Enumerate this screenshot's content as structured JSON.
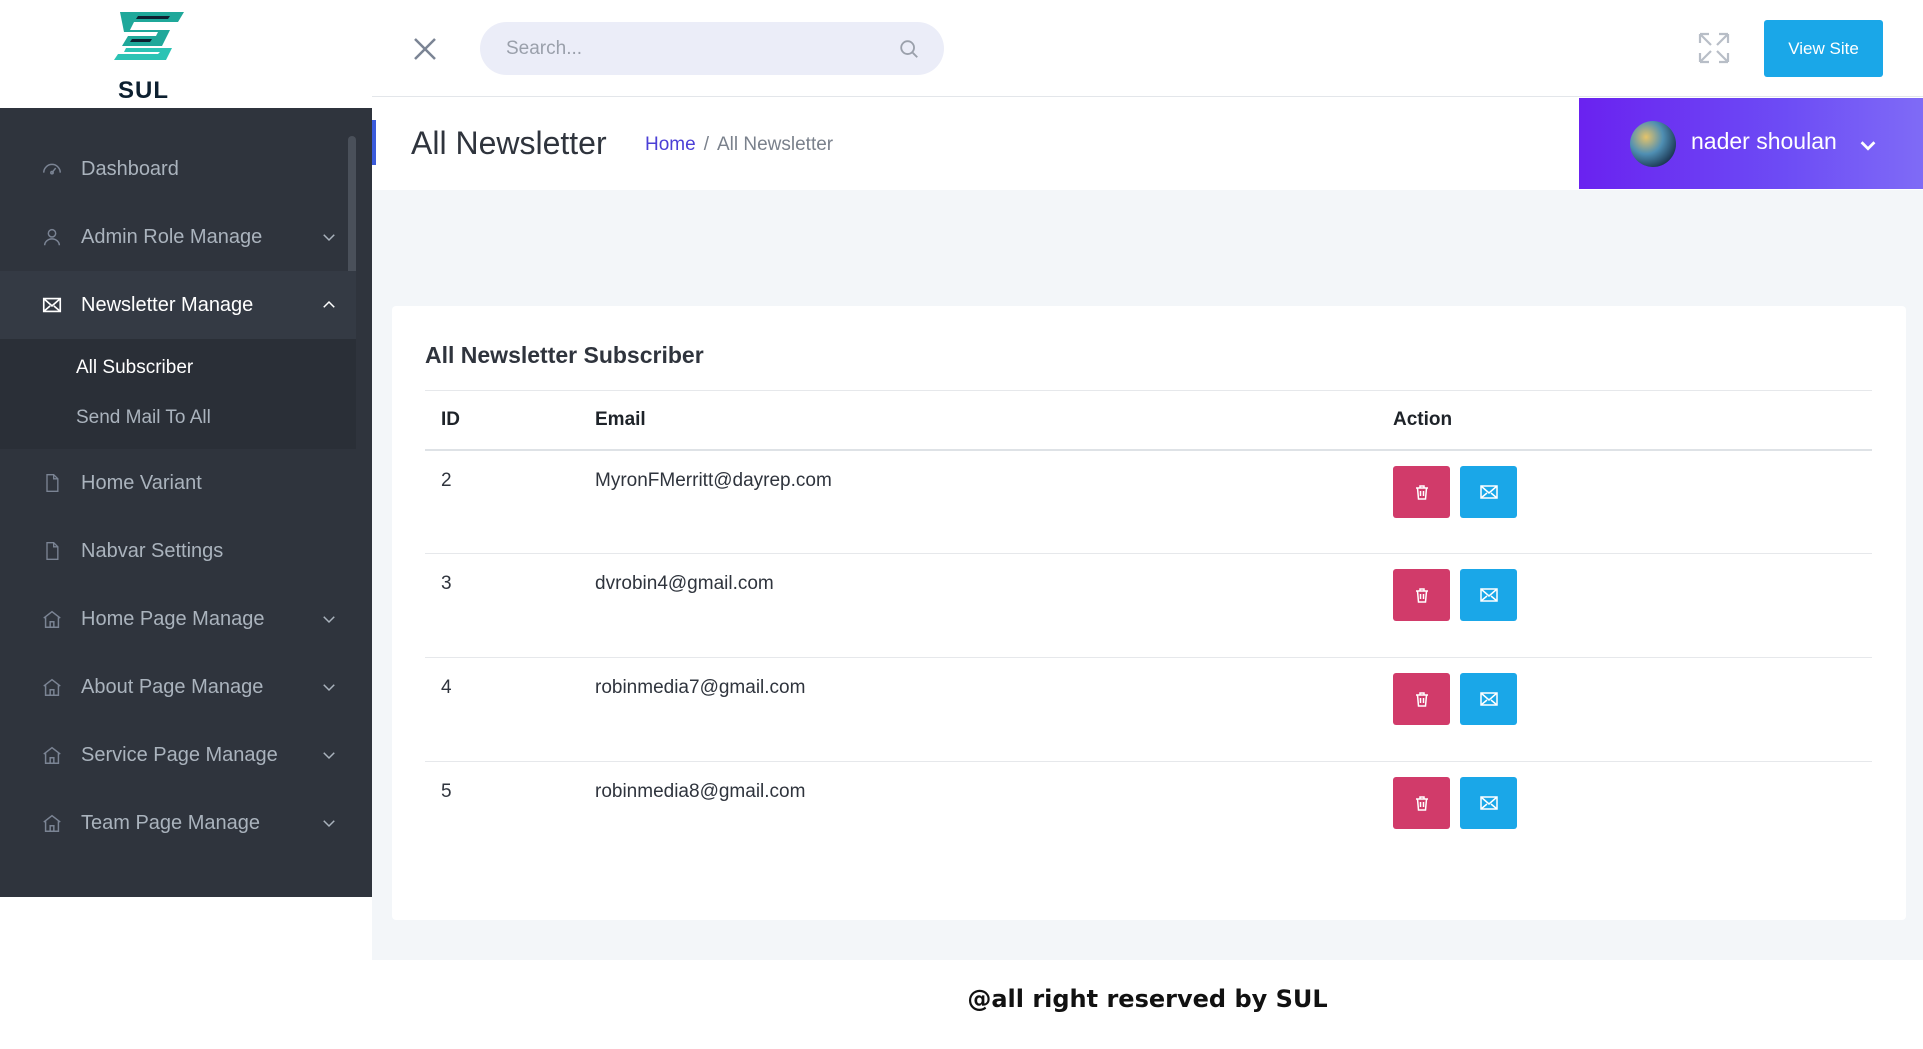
{
  "brand": {
    "logo_text": "SUL"
  },
  "sidebar": {
    "items": [
      {
        "label": "Dashboard",
        "icon": "dashboard-icon",
        "has_chevron": false
      },
      {
        "label": "Admin Role Manage",
        "icon": "user-icon",
        "has_chevron": true
      },
      {
        "label": "Newsletter Manage",
        "icon": "envelope-icon",
        "has_chevron": true,
        "expanded": true
      },
      {
        "label": "Home Variant",
        "icon": "file-icon",
        "has_chevron": false
      },
      {
        "label": "Nabvar Settings",
        "icon": "file-icon",
        "has_chevron": false
      },
      {
        "label": "Home Page Manage",
        "icon": "home-icon",
        "has_chevron": true
      },
      {
        "label": "About Page Manage",
        "icon": "home-icon",
        "has_chevron": true
      },
      {
        "label": "Service Page Manage",
        "icon": "home-icon",
        "has_chevron": true
      },
      {
        "label": "Team Page Manage",
        "icon": "home-icon",
        "has_chevron": true
      }
    ],
    "submenu": [
      {
        "label": "All Subscriber",
        "active": true
      },
      {
        "label": "Send Mail To All",
        "active": false
      }
    ]
  },
  "topbar": {
    "search_placeholder": "Search...",
    "view_site_label": "View Site"
  },
  "header": {
    "title": "All Newsletter",
    "breadcrumb_home": "Home",
    "breadcrumb_separator": "/",
    "breadcrumb_current": "All Newsletter",
    "user_name": "nader shoulan"
  },
  "table": {
    "title": "All Newsletter Subscriber",
    "columns": [
      "ID",
      "Email",
      "Action"
    ],
    "rows": [
      {
        "id": "2",
        "email": "MyronFMerritt@dayrep.com"
      },
      {
        "id": "3",
        "email": "dvrobin4@gmail.com"
      },
      {
        "id": "4",
        "email": "robinmedia7@gmail.com"
      },
      {
        "id": "5",
        "email": "robinmedia8@gmail.com"
      }
    ]
  },
  "colors": {
    "sidebar_bg": "#2f343d",
    "accent_blue": "#1aa7e8",
    "delete_pink": "#d13b6a",
    "user_gradient_start": "#6a22f0",
    "breadcrumb_link": "#4b3fd6"
  },
  "footer": {
    "text": "@all right reserved by SUL"
  }
}
